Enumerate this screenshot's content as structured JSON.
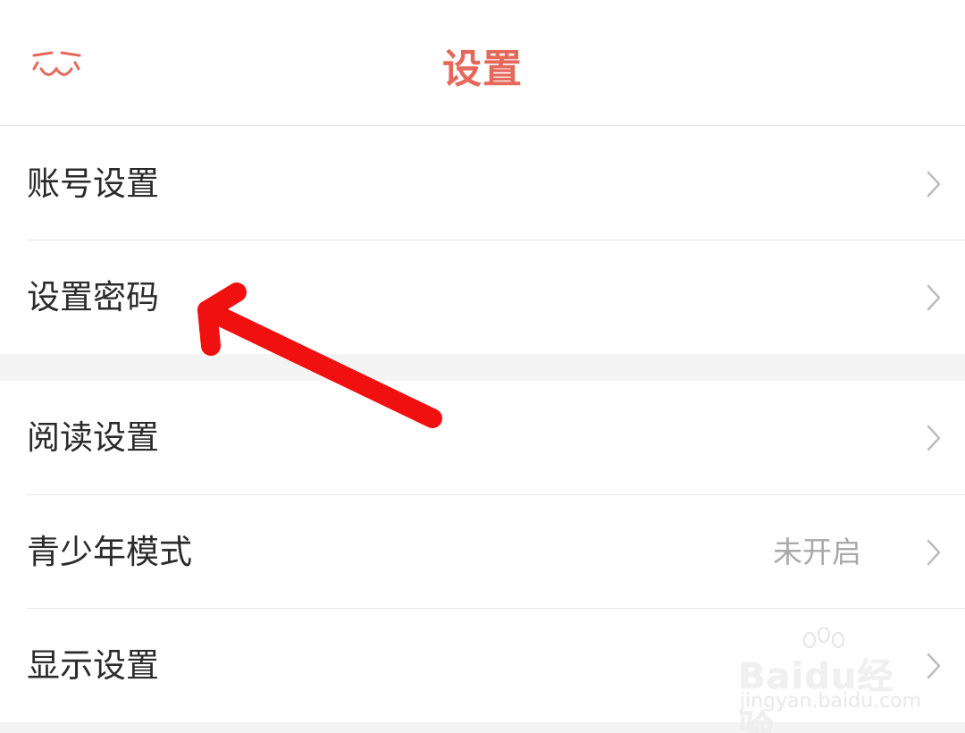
{
  "header": {
    "title": "设置",
    "back_icon": "cat-face-back-icon",
    "accent_color": "#e5685b"
  },
  "settings": {
    "group1": [
      {
        "label": "账号设置",
        "value": ""
      },
      {
        "label": "设置密码",
        "value": ""
      }
    ],
    "group2": [
      {
        "label": "阅读设置",
        "value": ""
      },
      {
        "label": "青少年模式",
        "value": "未开启"
      },
      {
        "label": "显示设置",
        "value": ""
      }
    ]
  },
  "annotation": {
    "color": "#f01010",
    "points_to": "设置密码"
  },
  "watermark": {
    "brand": "Baidu经验",
    "url": "jingyan.baidu.com"
  }
}
